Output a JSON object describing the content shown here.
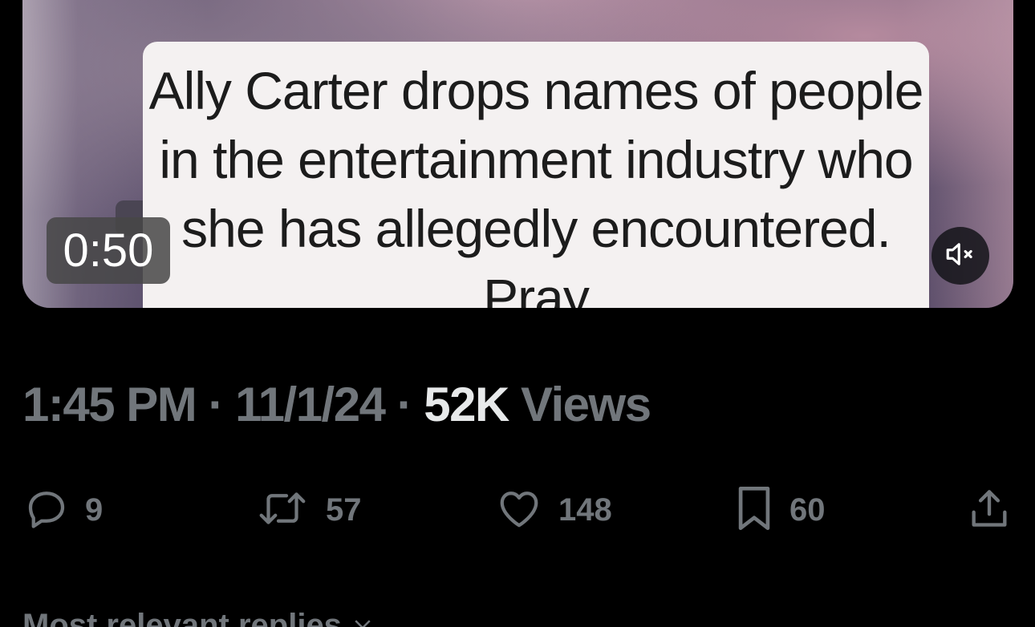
{
  "video": {
    "caption": "Ally Carter drops names of people in the entertainment industry who she has allegedly encountered. Pray",
    "duration": "0:50",
    "mute_icon": "speaker-muted-icon"
  },
  "meta": {
    "time": "1:45 PM",
    "separator": "·",
    "date": "11/1/24",
    "views_count": "52K",
    "views_label": "Views"
  },
  "actions": {
    "reply_count": "9",
    "repost_count": "57",
    "like_count": "148",
    "bookmark_count": "60",
    "icons": [
      "reply-icon",
      "repost-icon",
      "like-icon",
      "bookmark-icon",
      "share-icon"
    ]
  },
  "replies": {
    "sort_label": "Most relevant replies"
  },
  "colors": {
    "background": "#000000",
    "muted_text": "#71767b",
    "primary_text": "#e7e9ea"
  }
}
